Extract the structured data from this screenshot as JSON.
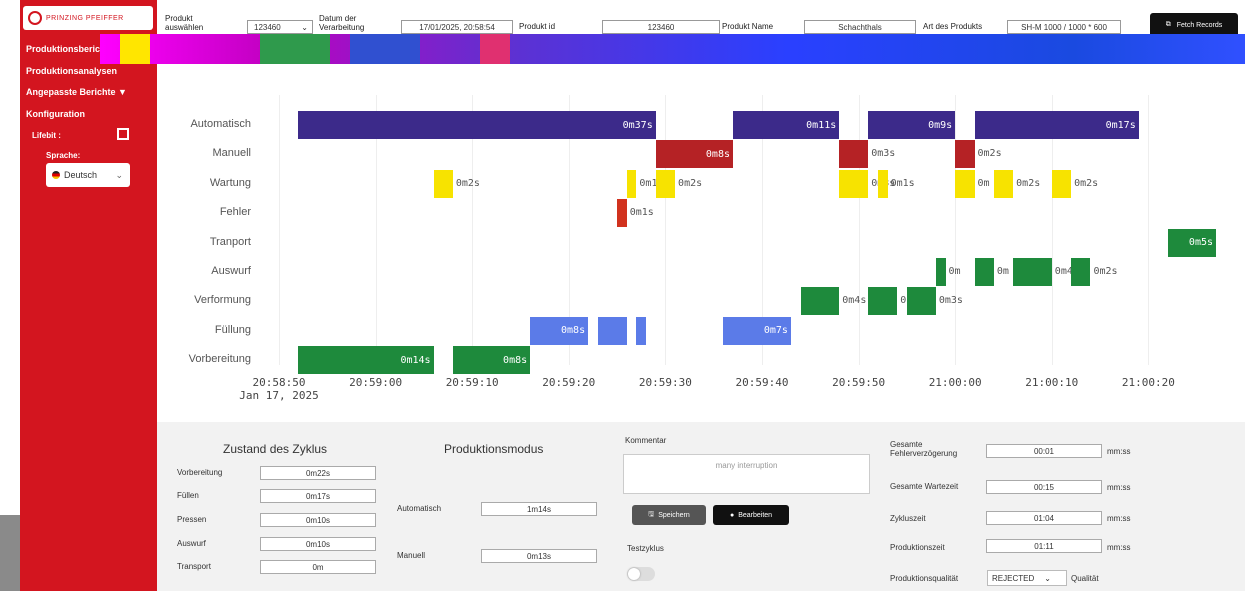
{
  "brand": {
    "logo_text": "PRINZING PFEIFFER"
  },
  "sidebar": {
    "items": [
      {
        "label": "Produktionsberichte"
      },
      {
        "label": "Produktionsanalysen"
      },
      {
        "label": "Angepasste Berichte ▼"
      },
      {
        "label": "Konfiguration"
      }
    ],
    "lifebit_label": "Lifebit :",
    "sprache_label": "Sprache:",
    "language": "Deutsch"
  },
  "topbar": {
    "produkt_auswaehlen_label": "Produkt auswählen",
    "produkt_value": "123460",
    "datum_label": "Datum der Verarbeitung",
    "datum_value": "17/01/2025, 20:58:54",
    "produkt_id_label": "Produkt id",
    "produkt_id_value": "123460",
    "produkt_name_label": "Produkt Name",
    "produkt_name_value": "Schachthals",
    "art_label": "Art des Produkts",
    "art_value": "SH-M 1000 / 1000 * 600",
    "fetch_label": "Fetch Records"
  },
  "chart_data": {
    "type": "gantt",
    "categories": [
      "Automatisch",
      "Manuell",
      "Wartung",
      "Fehler",
      "Tranport",
      "Auswurf",
      "Verformung",
      "Füllung",
      "Vorbereitung"
    ],
    "x_ticks": [
      "20:58:50\nJan 17, 2025",
      "20:59:00",
      "20:59:10",
      "20:59:20",
      "20:59:30",
      "20:59:40",
      "20:59:50",
      "21:00:00",
      "21:00:10",
      "21:00:20"
    ],
    "x_range": [
      "20:58:50",
      "21:00:30"
    ],
    "colors": {
      "Automatisch": "#3c2a8a",
      "Manuell": "#b52225",
      "Wartung": "#f7e300",
      "Fehler": "#d1321e",
      "Tranport": "#1e8a3c",
      "Auswurf": "#1e8a3c",
      "Verformung": "#1e8a3c",
      "Füllung": "#5b7be8",
      "Vorbereitung": "#1e8a3c"
    },
    "bars": [
      {
        "row": "Automatisch",
        "start": "20:58:52",
        "end": "20:59:29",
        "label": "0m37s"
      },
      {
        "row": "Automatisch",
        "start": "20:59:37",
        "end": "20:59:48",
        "label": "0m11s"
      },
      {
        "row": "Automatisch",
        "start": "20:59:51",
        "end": "21:00:00",
        "label": "0m9s"
      },
      {
        "row": "Automatisch",
        "start": "21:00:02",
        "end": "21:00:19",
        "label": "0m17s"
      },
      {
        "row": "Manuell",
        "start": "20:59:29",
        "end": "20:59:37",
        "label": "0m8s"
      },
      {
        "row": "Manuell",
        "start": "20:59:48",
        "end": "20:59:51",
        "label": "0m3s"
      },
      {
        "row": "Manuell",
        "start": "21:00:00",
        "end": "21:00:02",
        "label": "0m2s"
      },
      {
        "row": "Wartung",
        "start": "20:59:06",
        "end": "20:59:08",
        "label": "0m2s"
      },
      {
        "row": "Wartung",
        "start": "20:59:26",
        "end": "20:59:27",
        "label": "0m1s"
      },
      {
        "row": "Wartung",
        "start": "20:59:29",
        "end": "20:59:31",
        "label": "0m2s"
      },
      {
        "row": "Wartung",
        "start": "20:59:48",
        "end": "20:59:51",
        "label": "0m3s"
      },
      {
        "row": "Wartung",
        "start": "20:59:52",
        "end": "20:59:53",
        "label": "0m1s"
      },
      {
        "row": "Wartung",
        "start": "21:00:00",
        "end": "21:00:02",
        "label": "0m"
      },
      {
        "row": "Wartung",
        "start": "21:00:04",
        "end": "21:00:06",
        "label": "0m2s"
      },
      {
        "row": "Wartung",
        "start": "21:00:10",
        "end": "21:00:12",
        "label": "0m2s"
      },
      {
        "row": "Fehler",
        "start": "20:59:25",
        "end": "20:59:26",
        "label": "0m1s"
      },
      {
        "row": "Tranport",
        "start": "21:00:22",
        "end": "21:00:27",
        "label": "0m5s"
      },
      {
        "row": "Auswurf",
        "start": "20:59:58",
        "end": "20:59:59",
        "label": "0m"
      },
      {
        "row": "Auswurf",
        "start": "21:00:02",
        "end": "21:00:04",
        "label": "0m"
      },
      {
        "row": "Auswurf",
        "start": "21:00:06",
        "end": "21:00:10",
        "label": "0m4s"
      },
      {
        "row": "Auswurf",
        "start": "21:00:12",
        "end": "21:00:14",
        "label": "0m2s"
      },
      {
        "row": "Verformung",
        "start": "20:59:44",
        "end": "20:59:48",
        "label": "0m4s"
      },
      {
        "row": "Verformung",
        "start": "20:59:51",
        "end": "20:59:54",
        "label": "0"
      },
      {
        "row": "Verformung",
        "start": "20:59:55",
        "end": "20:59:58",
        "label": "0m3s"
      },
      {
        "row": "Füllung",
        "start": "20:59:16",
        "end": "20:59:22",
        "label": "0m8s"
      },
      {
        "row": "Füllung",
        "start": "20:59:23",
        "end": "20:59:26",
        "label": ""
      },
      {
        "row": "Füllung",
        "start": "20:59:27",
        "end": "20:59:28",
        "label": ""
      },
      {
        "row": "Füllung",
        "start": "20:59:36",
        "end": "20:59:43",
        "label": "0m7s"
      },
      {
        "row": "Vorbereitung",
        "start": "20:58:52",
        "end": "20:59:06",
        "label": "0m14s"
      },
      {
        "row": "Vorbereitung",
        "start": "20:59:08",
        "end": "20:59:16",
        "label": "0m8s"
      }
    ]
  },
  "zustand": {
    "title": "Zustand des Zyklus",
    "rows": [
      {
        "label": "Vorbereitung",
        "value": "0m22s"
      },
      {
        "label": "Füllen",
        "value": "0m17s"
      },
      {
        "label": "Pressen",
        "value": "0m10s"
      },
      {
        "label": "Auswurf",
        "value": "0m10s"
      },
      {
        "label": "Transport",
        "value": "0m"
      }
    ]
  },
  "produktionsmodus": {
    "title": "Produktionsmodus",
    "rows": [
      {
        "label": "Automatisch",
        "value": "1m14s"
      },
      {
        "label": "Manuell",
        "value": "0m13s"
      }
    ]
  },
  "kommentar": {
    "label": "Kommentar",
    "placeholder": "many interruption",
    "save_label": "Speichern",
    "edit_label": "Bearbeiten",
    "testzyklus_label": "Testzyklus"
  },
  "times": {
    "rows": [
      {
        "label": "Gesamte Fehlerverzögerung",
        "value": "00:01",
        "unit": "mm:ss"
      },
      {
        "label": "Gesamte Wartezeit",
        "value": "00:15",
        "unit": "mm:ss"
      },
      {
        "label": "Zykluszeit",
        "value": "01:04",
        "unit": "mm:ss"
      },
      {
        "label": "Produktionszeit",
        "value": "01:11",
        "unit": "mm:ss"
      }
    ],
    "quality_label": "Produktionsqualität",
    "quality_value": "REJECTED",
    "quality_suffix": "Qualität"
  }
}
